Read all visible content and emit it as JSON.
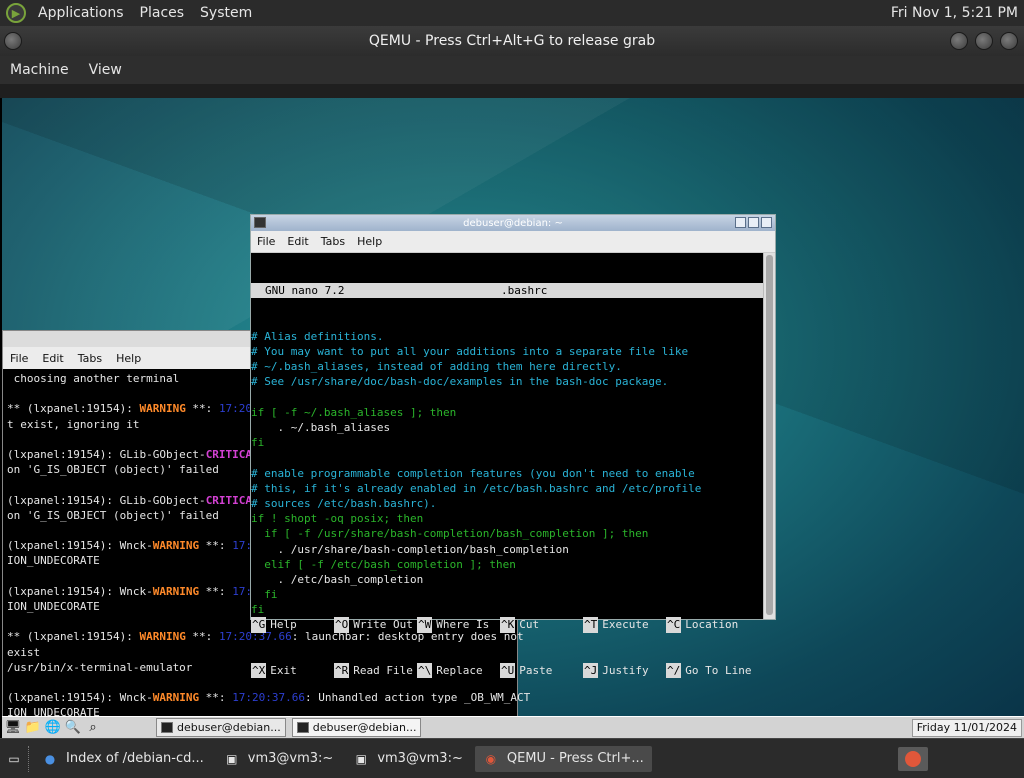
{
  "host_panel": {
    "menus": [
      "Applications",
      "Places",
      "System"
    ],
    "clock": "Fri Nov 1,  5:21 PM"
  },
  "qemu": {
    "title": "QEMU - Press Ctrl+Alt+G to release grab",
    "menu": [
      "Machine",
      "View"
    ]
  },
  "term_front": {
    "title": "debuser@debian: ~",
    "menu": [
      "File",
      "Edit",
      "Tabs",
      "Help"
    ]
  },
  "nano": {
    "version": "GNU nano 7.2",
    "filename": ".bashrc",
    "lines": [
      "# Alias definitions.",
      "# You may want to put all your additions into a separate file like",
      "# ~/.bash_aliases, instead of adding them here directly.",
      "# See /usr/share/doc/bash-doc/examples in the bash-doc package.",
      "",
      "if [ -f ~/.bash_aliases ]; then",
      "    . ~/.bash_aliases",
      "fi",
      "",
      "# enable programmable completion features (you don't need to enable",
      "# this, if it's already enabled in /etc/bash.bashrc and /etc/profile",
      "# sources /etc/bash.bashrc).",
      "if ! shopt -oq posix; then",
      "  if [ -f /usr/share/bash-completion/bash_completion ]; then",
      "    . /usr/share/bash-completion/bash_completion",
      "  elif [ -f /etc/bash_completion ]; then",
      "    . /etc/bash_completion",
      "  fi",
      "fi"
    ],
    "shortcuts_row1": [
      {
        "key": "^G",
        "label": "Help"
      },
      {
        "key": "^O",
        "label": "Write Out"
      },
      {
        "key": "^W",
        "label": "Where Is"
      },
      {
        "key": "^K",
        "label": "Cut"
      },
      {
        "key": "^T",
        "label": "Execute"
      },
      {
        "key": "^C",
        "label": "Location"
      }
    ],
    "shortcuts_row2": [
      {
        "key": "^X",
        "label": "Exit"
      },
      {
        "key": "^R",
        "label": "Read File"
      },
      {
        "key": "^\\",
        "label": "Replace"
      },
      {
        "key": "^U",
        "label": "Paste"
      },
      {
        "key": "^J",
        "label": "Justify"
      },
      {
        "key": "^/",
        "label": "Go To Line"
      }
    ]
  },
  "term_back": {
    "title": "debuse",
    "menu": [
      "File",
      "Edit",
      "Tabs",
      "Help"
    ],
    "lines": {
      "l1": " choosing another terminal",
      "l3a": "** (lxpanel:19154): ",
      "l3b": "WARNING",
      "l3c": " **: ",
      "l4": "t exist, ignoring it",
      "l6a": "(lxpanel:19154): GLib-GObject-",
      "l6b": "CRITICAL",
      "l7": "on 'G_IS_OBJECT (object)' failed",
      "l9a": "(lxpanel:19154): GLib-GObject-",
      "l9b": "CRITICAL",
      "l10": "on 'G_IS_OBJECT (object)' failed",
      "l12a": "(lxpanel:19154): Wnck-",
      "l12b": "WARNING",
      "l12c": " **: ",
      "l13": "ION_UNDECORATE",
      "l15a": "(lxpanel:19154): Wnck-",
      "l15b": "WARNING",
      "l15c": " **: ",
      "l16": "ION_UNDECORATE",
      "l18a": "** (lxpanel:19154): ",
      "l18b": "WARNING",
      "l18c": " **: ",
      "l18d": ": launchbar: desktop entry does not",
      "l19": "exist",
      "l20": "/usr/bin/x-terminal-emulator",
      "l22a": "(lxpanel:19154): Wnck-",
      "l22b": "WARNING",
      "l22c": " **: ",
      "l22d": ": Unhandled action type _OB_WM_ACT",
      "l23": "ION_UNDECORATE"
    }
  },
  "guest_taskbar": {
    "tasks": [
      "debuser@debian...",
      "debuser@debian..."
    ],
    "date": "Friday 11/01/2024"
  },
  "host_taskbar": {
    "items": [
      "Index of /debian-cd...",
      "vm3@vm3:~",
      "vm3@vm3:~",
      "QEMU - Press Ctrl+..."
    ]
  }
}
